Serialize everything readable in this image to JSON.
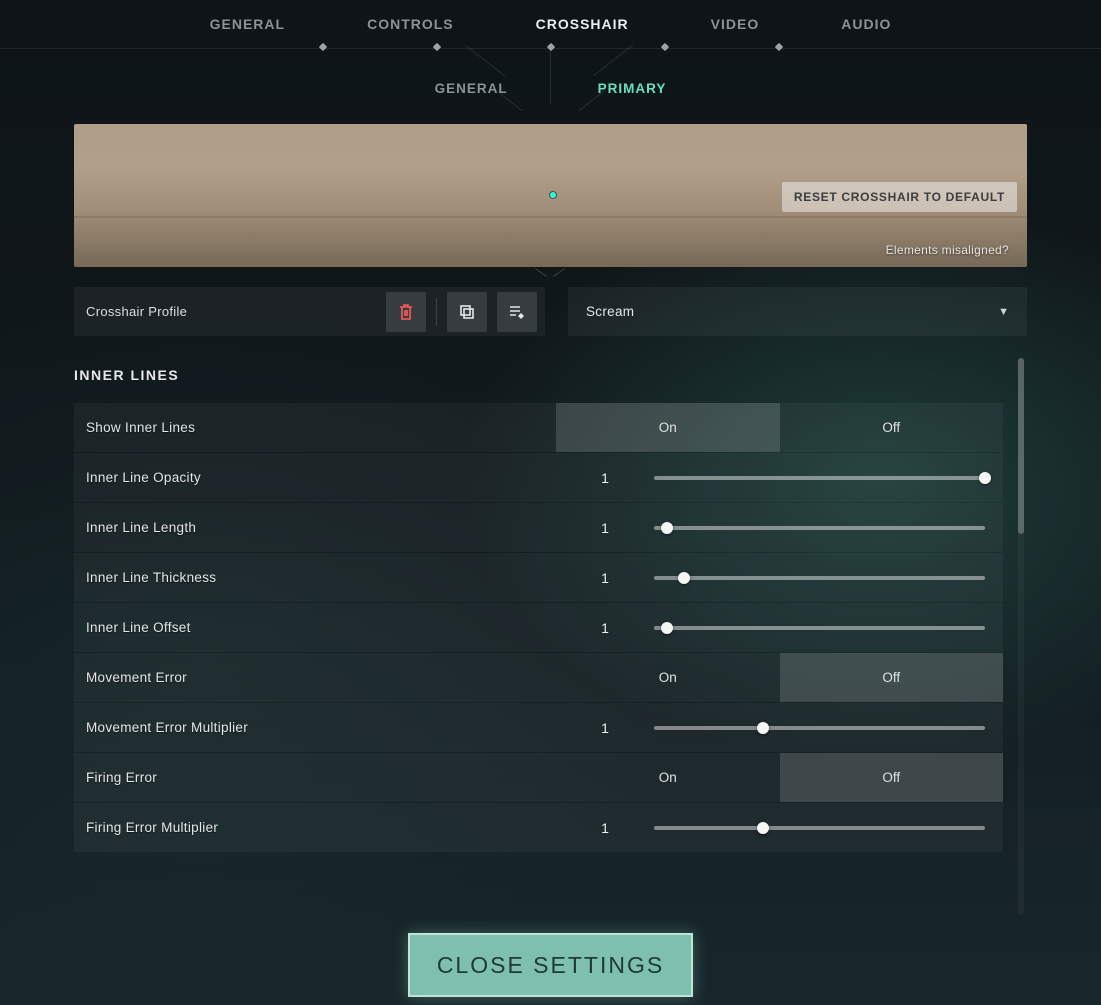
{
  "nav": {
    "tabs": [
      "GENERAL",
      "CONTROLS",
      "CROSSHAIR",
      "VIDEO",
      "AUDIO"
    ],
    "active": 2,
    "subtabs": [
      "GENERAL",
      "PRIMARY"
    ],
    "sub_active": 1
  },
  "preview": {
    "reset_label": "RESET CROSSHAIR TO DEFAULT",
    "misaligned_label": "Elements misaligned?"
  },
  "profile": {
    "label": "Crosshair Profile",
    "icons": [
      "trash-icon",
      "duplicate-icon",
      "edit-list-icon"
    ],
    "selected": "Scream"
  },
  "section_title": "INNER LINES",
  "labels": {
    "on": "On",
    "off": "Off"
  },
  "rows": [
    {
      "label": "Show Inner Lines",
      "type": "toggle",
      "value": "on"
    },
    {
      "label": "Inner Line Opacity",
      "type": "slider",
      "value": "1",
      "pct": 100
    },
    {
      "label": "Inner Line Length",
      "type": "slider",
      "value": "1",
      "pct": 4
    },
    {
      "label": "Inner Line Thickness",
      "type": "slider",
      "value": "1",
      "pct": 9
    },
    {
      "label": "Inner Line Offset",
      "type": "slider",
      "value": "1",
      "pct": 4
    },
    {
      "label": "Movement Error",
      "type": "toggle",
      "value": "off"
    },
    {
      "label": "Movement Error Multiplier",
      "type": "slider",
      "value": "1",
      "pct": 33
    },
    {
      "label": "Firing Error",
      "type": "toggle",
      "value": "off"
    },
    {
      "label": "Firing Error Multiplier",
      "type": "slider",
      "value": "1",
      "pct": 33
    }
  ],
  "close_label": "CLOSE SETTINGS",
  "colors": {
    "accent": "#66e2c0",
    "danger": "#ff5a59"
  }
}
